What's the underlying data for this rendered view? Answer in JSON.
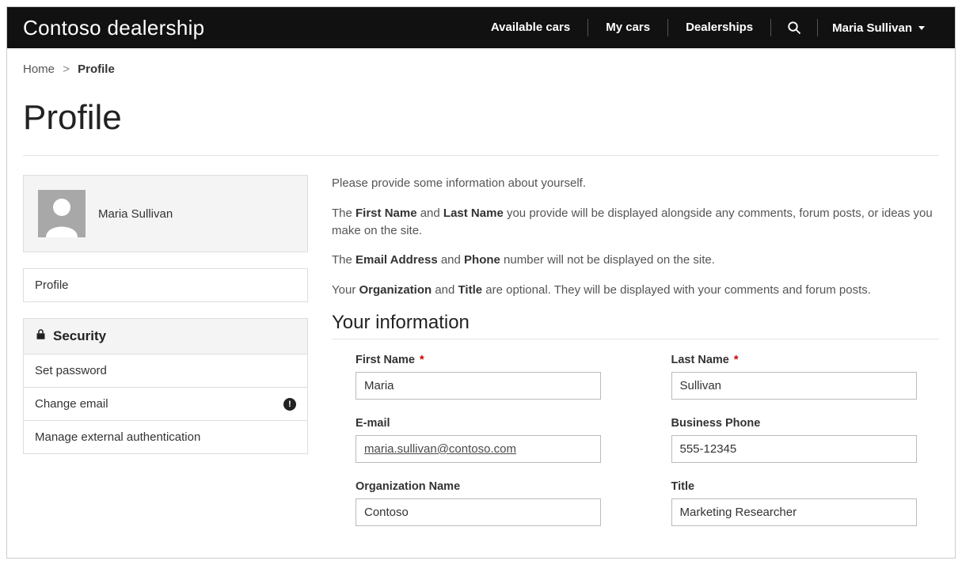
{
  "header": {
    "brand": "Contoso dealership",
    "nav": {
      "available_cars": "Available cars",
      "my_cars": "My cars",
      "dealerships": "Dealerships"
    },
    "user_name": "Maria Sullivan"
  },
  "breadcrumb": {
    "home": "Home",
    "current": "Profile"
  },
  "page_title": "Profile",
  "sidebar": {
    "user_display_name": "Maria Sullivan",
    "nav1": {
      "profile": "Profile"
    },
    "security_header": "Security",
    "nav2": {
      "set_password": "Set password",
      "change_email": "Change email",
      "manage_ext_auth": "Manage external authentication"
    }
  },
  "intro": {
    "p1": "Please provide some information about yourself.",
    "p2_a": "The ",
    "p2_b1": "First Name",
    "p2_c": " and ",
    "p2_b2": "Last Name",
    "p2_d": " you provide will be displayed alongside any comments, forum posts, or ideas you make on the site.",
    "p3_a": "The ",
    "p3_b1": "Email Address",
    "p3_c": " and ",
    "p3_b2": "Phone",
    "p3_d": " number will not be displayed on the site.",
    "p4_a": "Your ",
    "p4_b1": "Organization",
    "p4_c": " and ",
    "p4_b2": "Title",
    "p4_d": " are optional. They will be displayed with your comments and forum posts."
  },
  "section_heading": "Your information",
  "form": {
    "first_name": {
      "label": "First Name",
      "value": "Maria",
      "required": true
    },
    "last_name": {
      "label": "Last Name",
      "value": "Sullivan",
      "required": true
    },
    "email": {
      "label": "E-mail",
      "value": "maria.sullivan@contoso.com"
    },
    "business_phone": {
      "label": "Business Phone",
      "value": "555-12345"
    },
    "org_name": {
      "label": "Organization Name",
      "value": "Contoso"
    },
    "title": {
      "label": "Title",
      "value": "Marketing Researcher"
    }
  }
}
